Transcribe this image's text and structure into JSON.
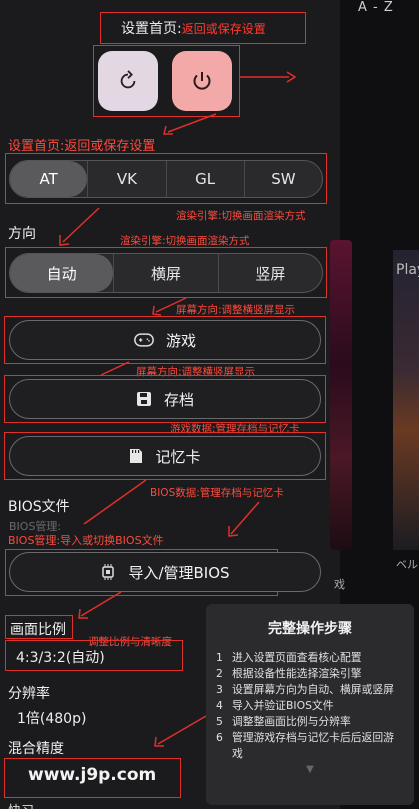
{
  "top_right": "A - Z",
  "top_title": {
    "main": "设置首页:",
    "note": "返回或保存设置"
  },
  "note_home": "设置首页:返回或保存设置",
  "renderer": {
    "options": [
      "AT",
      "VK",
      "GL",
      "SW"
    ],
    "selected": "AT",
    "note1": "渲染引擎:切换画面渲染方式",
    "note2": "渲染引擎:切换画面渲染方式"
  },
  "orientation": {
    "label": "方向",
    "options": [
      "自动",
      "横屏",
      "竖屏"
    ],
    "selected": "自动",
    "note1": "屏幕方向:调整横竖屏显示",
    "note2": "屏幕方向:调整横竖屏显示"
  },
  "buttons": {
    "game": "游戏",
    "save": "存档",
    "memcard": "记忆卡"
  },
  "game_data_note": "游戏数据:管理存档与记忆卡",
  "bios": {
    "label": "BIOS文件",
    "note_right": "BIOS数据:管理存档与记忆卡",
    "manage_faint": "BIOS管理:",
    "manage_note": "BIOS管理:导入或切换BIOS文件",
    "button": "导入/管理BIOS"
  },
  "aspect": {
    "label": "画面比例",
    "note": "调整比例与清晰度",
    "value": "4:3/3:2(自动)"
  },
  "resolution": {
    "label": "分辨率",
    "value": "1倍(480p)"
  },
  "precision": {
    "label": "混合精度"
  },
  "watermark": "www.j9p.com",
  "bottom_cut": "快习",
  "bg_text": {
    "play": "Play",
    "ba": "ベル",
    "ji": "戏"
  },
  "steps": {
    "title": "完整操作步骤",
    "items": [
      {
        "n": "1",
        "text": "进入设置页面查看核心配置"
      },
      {
        "n": "2",
        "text": "根据设备性能选择渲染引擎"
      },
      {
        "n": "3",
        "text": "设置屏幕方向为自动、横屏或竖屏"
      },
      {
        "n": "4",
        "text": "导入并验证BIOS文件"
      },
      {
        "n": "5",
        "text": "调整整画面比例与分辨率"
      },
      {
        "n": "6",
        "text": "管理游戏存档与记忆卡后后返回游戏"
      }
    ]
  }
}
